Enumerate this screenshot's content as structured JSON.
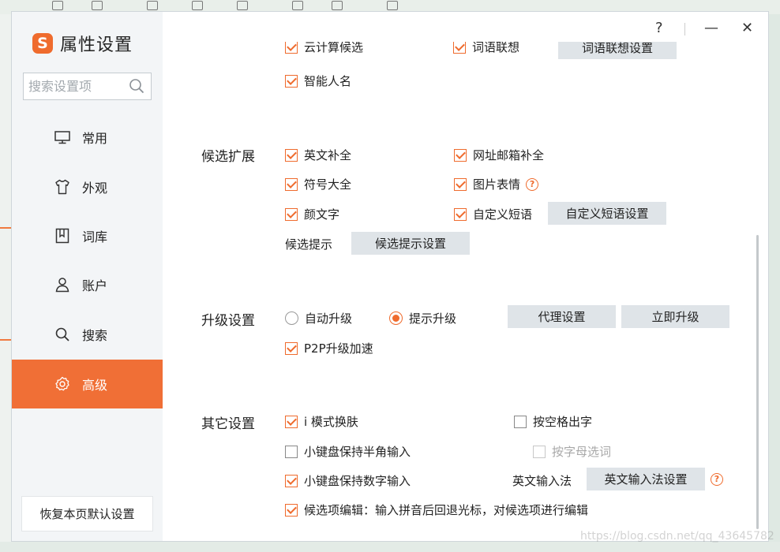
{
  "window": {
    "title": "属性设置",
    "logo_glyph": "S",
    "help_glyph": "?",
    "minimize_glyph": "—",
    "close_glyph": "✕"
  },
  "search": {
    "placeholder": "搜索设置项"
  },
  "sidebar": {
    "items": [
      {
        "label": "常用",
        "icon": "monitor-icon"
      },
      {
        "label": "外观",
        "icon": "shirt-icon"
      },
      {
        "label": "词库",
        "icon": "book-icon"
      },
      {
        "label": "账户",
        "icon": "user-icon"
      },
      {
        "label": "搜索",
        "icon": "search-icon"
      },
      {
        "label": "高级",
        "icon": "gear-icon",
        "active": true
      }
    ],
    "restore_label": "恢复本页默认设置"
  },
  "top_partial": {
    "cloud": "云计算候选",
    "lenovo": "词语联想",
    "lenovo_btn": "词语联想设置",
    "smart_name": "智能人名"
  },
  "candidate_ext": {
    "title": "候选扩展",
    "english_complete": "英文补全",
    "url_email": "网址邮箱补全",
    "symbols": "符号大全",
    "pic_emoji": "图片表情",
    "kaomoji": "颜文字",
    "custom_phrase": "自定义短语",
    "custom_phrase_btn": "自定义短语设置",
    "hint_label": "候选提示",
    "hint_btn": "候选提示设置"
  },
  "upgrade": {
    "title": "升级设置",
    "auto": "自动升级",
    "prompt": "提示升级",
    "proxy_btn": "代理设置",
    "now_btn": "立即升级",
    "p2p": "P2P升级加速"
  },
  "other": {
    "title": "其它设置",
    "i_mode": "i 模式换肤",
    "space_out": "按空格出字",
    "keypad_half": "小键盘保持半角输入",
    "letter_select": "按字母选词",
    "keypad_num": "小键盘保持数字输入",
    "eng_ime_label": "英文输入法",
    "eng_ime_btn": "英文输入法设置",
    "candidate_edit": "候选项编辑：输入拼音后回退光标，对候选项进行编辑"
  },
  "watermark": "https://blog.csdn.net/qq_43645782",
  "colors": {
    "accent": "#f06f36",
    "sidebar_bg": "#f3f5f7",
    "button_bg": "#dfe4e8"
  }
}
